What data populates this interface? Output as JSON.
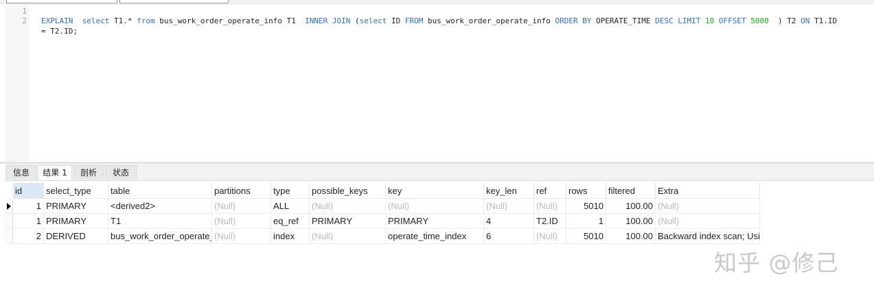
{
  "editor": {
    "line_numbers": [
      "1",
      "2"
    ],
    "sql_tokens": [
      {
        "t": "EXPLAIN",
        "c": "kw"
      },
      {
        "t": "  ",
        "c": ""
      },
      {
        "t": "select",
        "c": "kw"
      },
      {
        "t": " T1.* ",
        "c": ""
      },
      {
        "t": "from",
        "c": "kw"
      },
      {
        "t": " bus_work_order_operate_info T1  ",
        "c": ""
      },
      {
        "t": "INNER JOIN",
        "c": "kw"
      },
      {
        "t": " (",
        "c": ""
      },
      {
        "t": "select",
        "c": "kw"
      },
      {
        "t": " ID ",
        "c": ""
      },
      {
        "t": "FROM",
        "c": "kw"
      },
      {
        "t": " bus_work_order_operate_info ",
        "c": ""
      },
      {
        "t": "ORDER BY",
        "c": "kw"
      },
      {
        "t": " OPERATE_TIME ",
        "c": ""
      },
      {
        "t": "DESC LIMIT",
        "c": "kw"
      },
      {
        "t": " ",
        "c": ""
      },
      {
        "t": "10",
        "c": "num"
      },
      {
        "t": " ",
        "c": ""
      },
      {
        "t": "OFFSET",
        "c": "kw"
      },
      {
        "t": " ",
        "c": ""
      },
      {
        "t": "5000",
        "c": "num"
      },
      {
        "t": "  ) T2 ",
        "c": ""
      },
      {
        "t": "ON",
        "c": "kw"
      },
      {
        "t": " T1.ID",
        "c": ""
      }
    ],
    "sql_line2": "= T2.ID;"
  },
  "tabs": [
    "信息",
    "结果 1",
    "剖析",
    "状态"
  ],
  "active_tab": 1,
  "result": {
    "columns": [
      "id",
      "select_type",
      "table",
      "partitions",
      "type",
      "possible_keys",
      "key",
      "key_len",
      "ref",
      "rows",
      "filtered",
      "Extra"
    ],
    "rows": [
      [
        "1",
        "PRIMARY",
        "<derived2>",
        "(Null)",
        "ALL",
        "(Null)",
        "(Null)",
        "(Null)",
        "(Null)",
        "5010",
        "100.00",
        "(Null)"
      ],
      [
        "1",
        "PRIMARY",
        "T1",
        "(Null)",
        "eq_ref",
        "PRIMARY",
        "PRIMARY",
        "4",
        "T2.ID",
        "1",
        "100.00",
        "(Null)"
      ],
      [
        "2",
        "DERIVED",
        "bus_work_order_operate_info",
        "(Null)",
        "index",
        "(Null)",
        "operate_time_index",
        "6",
        "(Null)",
        "5010",
        "100.00",
        "Backward index scan; Using index"
      ]
    ],
    "selected_row": 0
  },
  "watermark": "知乎 @修己"
}
